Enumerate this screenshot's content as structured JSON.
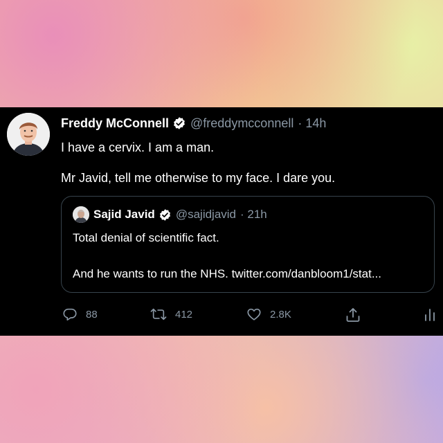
{
  "tweet": {
    "author_name": "Freddy McConnell",
    "handle": "@freddymcconnell",
    "time": "· 14h",
    "line1": "I have a cervix. I am a man.",
    "line2": "Mr Javid, tell me otherwise to my face. I dare you.",
    "verified_icon": "verified-badge-icon"
  },
  "quoted_tweet": {
    "author_name": "Sajid Javid",
    "handle": "@sajidjavid",
    "time": "· 21h",
    "line1": "Total denial of scientific fact.",
    "line2": "And he wants to run the NHS. twitter.com/danbloom1/stat..."
  },
  "actions": {
    "reply_count": "88",
    "retweet_count": "412",
    "like_count": "2.8K"
  },
  "colors": {
    "card_bg": "#000000",
    "text": "#ffffff",
    "muted": "#8b98a5",
    "border": "#38444d"
  }
}
